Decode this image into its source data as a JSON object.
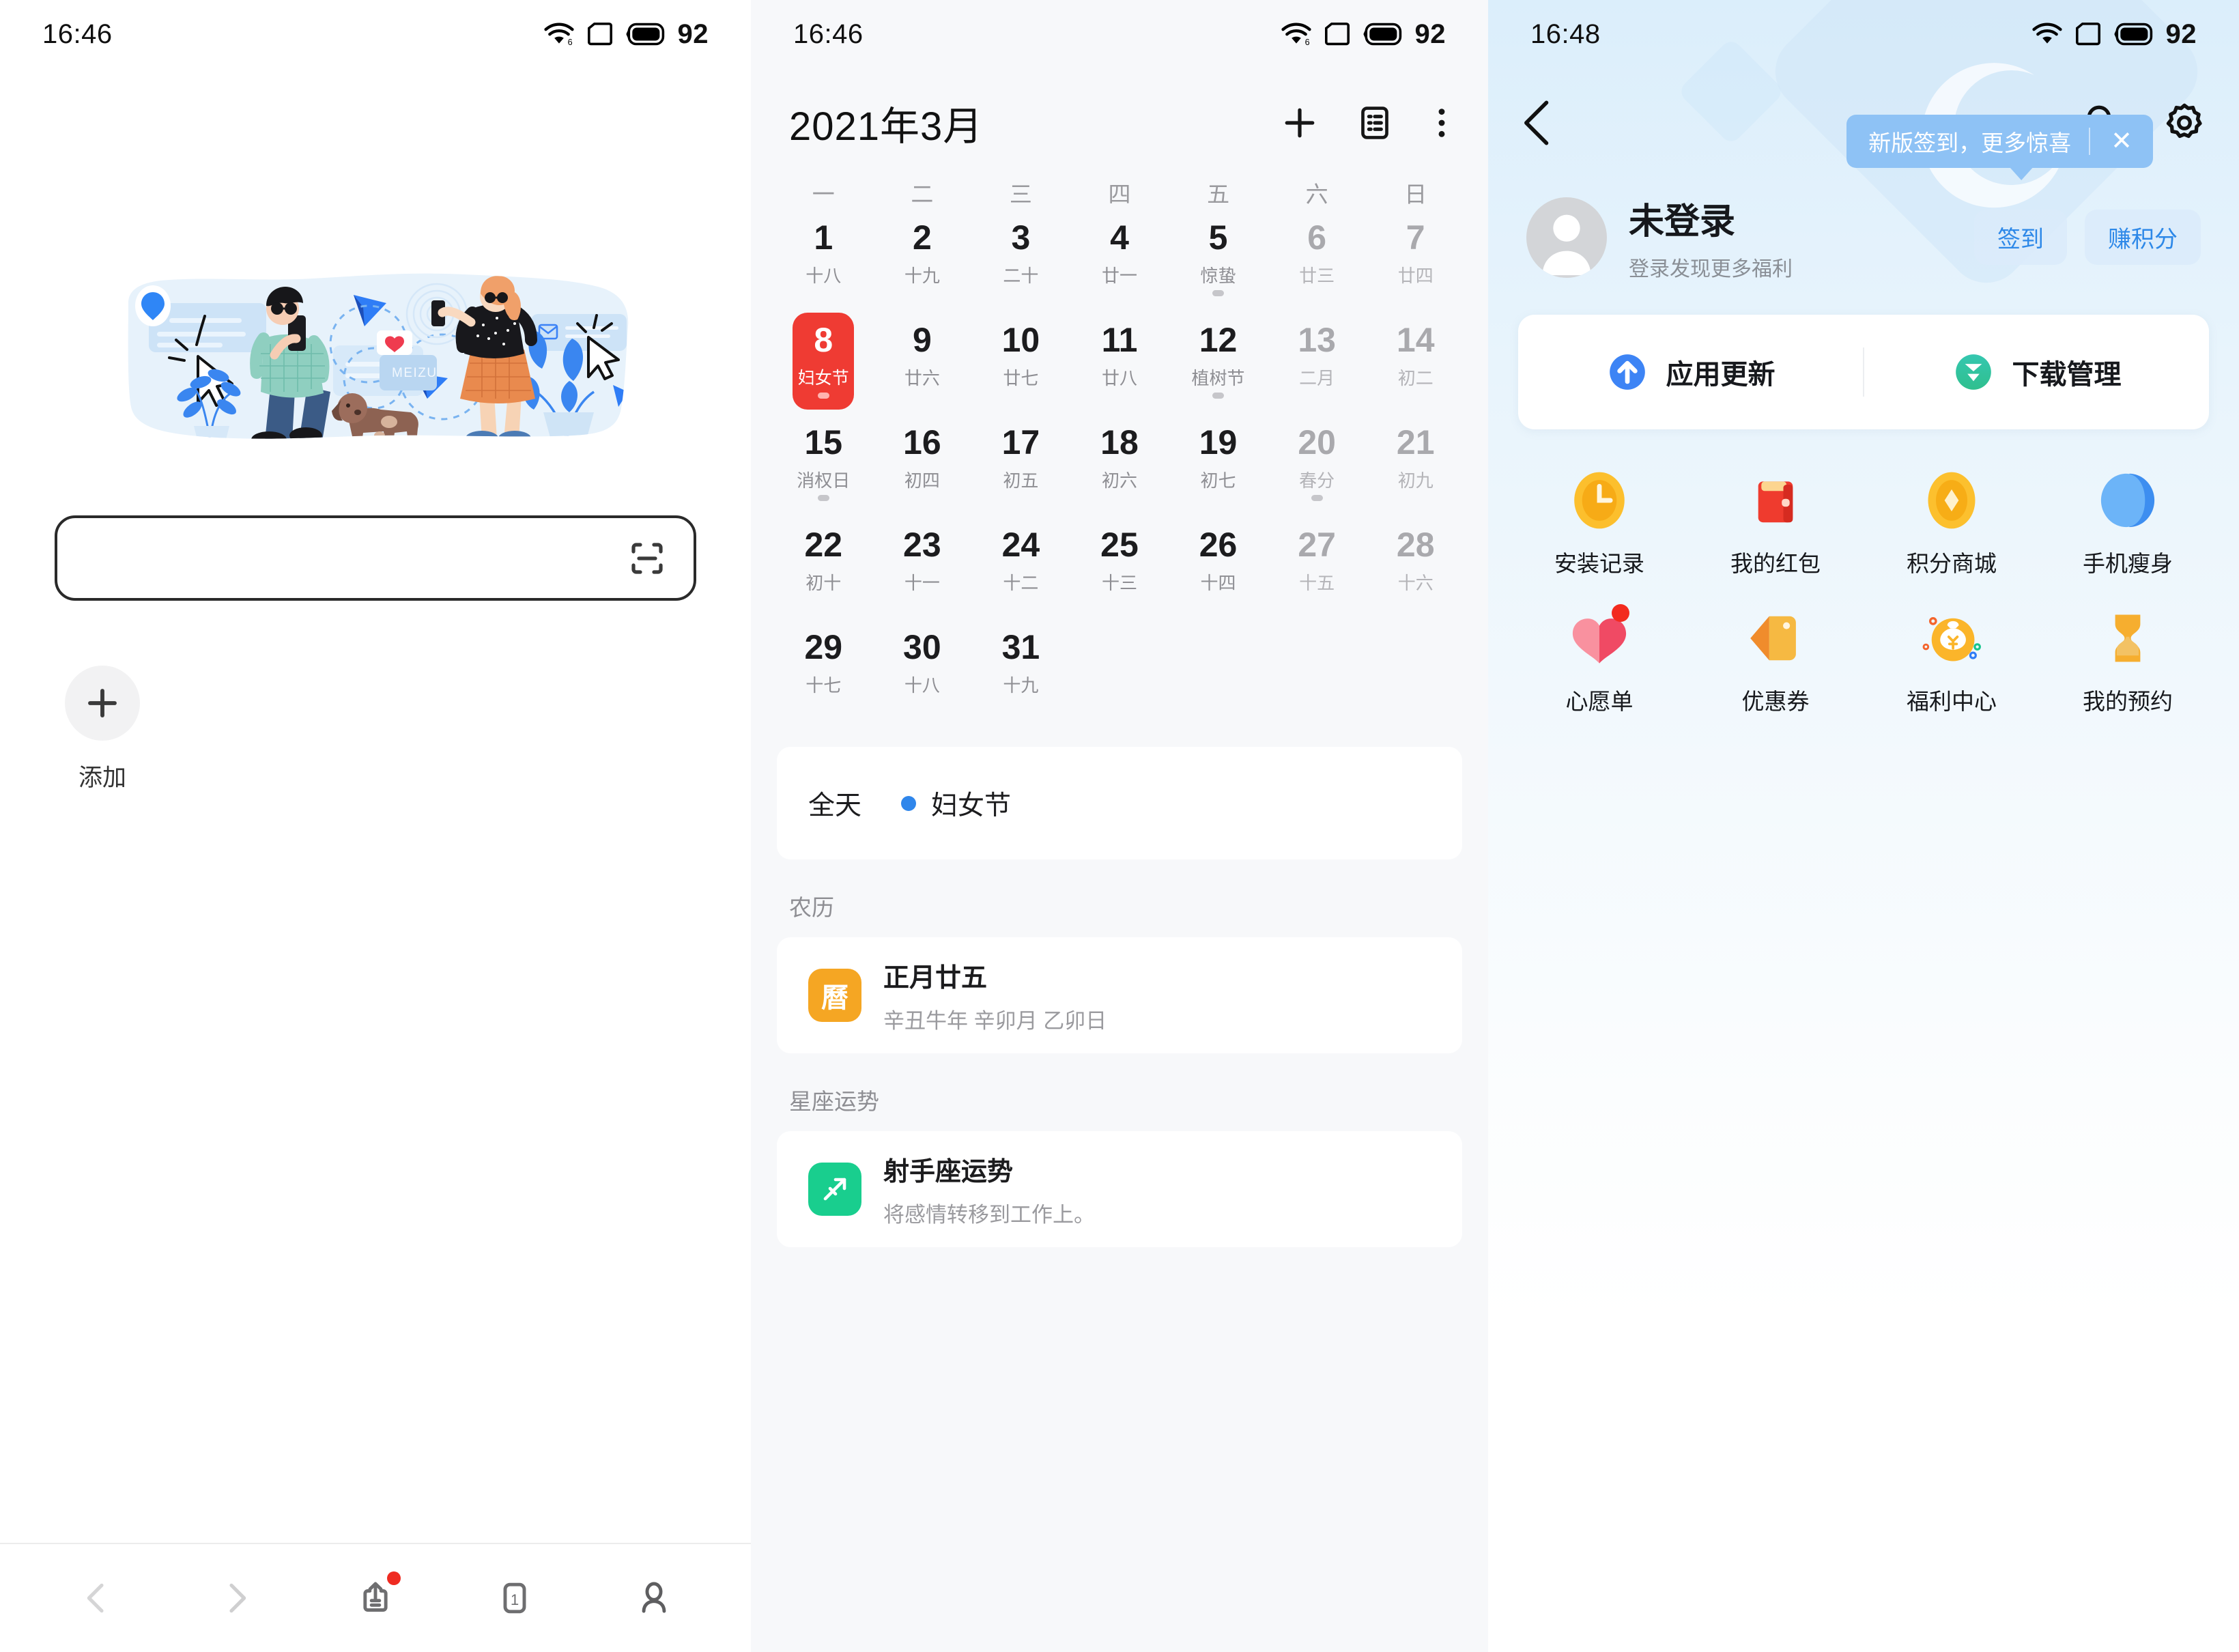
{
  "panel1": {
    "status": {
      "time": "16:46",
      "wifi_icon": "wifi-6-icon",
      "sim_icon": "sim-card-icon",
      "battery_icon": "battery-icon",
      "battery_level": "92"
    },
    "illustration": {
      "name": "meizu-browser-illustration",
      "brand_text": "MEIZU"
    },
    "search": {
      "value": "",
      "placeholder": "",
      "scan_icon": "scan-qr-icon"
    },
    "add_shortcut": {
      "icon": "plus-icon",
      "label": "添加"
    },
    "bottom_nav": [
      {
        "name": "back",
        "icon": "chevron-left-icon",
        "label": "",
        "disabled": true,
        "badge": false
      },
      {
        "name": "forward",
        "icon": "chevron-right-icon",
        "label": "",
        "disabled": true,
        "badge": false
      },
      {
        "name": "share",
        "icon": "share-upload-icon",
        "label": "",
        "disabled": false,
        "badge": true
      },
      {
        "name": "tabs",
        "icon": "tab-count-icon",
        "label": "1",
        "disabled": false,
        "badge": false
      },
      {
        "name": "profile",
        "icon": "person-icon",
        "label": "",
        "disabled": false,
        "badge": false
      }
    ]
  },
  "panel2": {
    "status": {
      "time": "16:46",
      "wifi_icon": "wifi-6-icon",
      "sim_icon": "sim-card-icon",
      "battery_icon": "battery-icon",
      "battery_level": "92"
    },
    "header": {
      "title": "2021年3月",
      "add_icon": "plus-icon",
      "agenda_icon": "agenda-list-icon",
      "more_icon": "more-vertical-icon"
    },
    "weekdays": [
      "一",
      "二",
      "三",
      "四",
      "五",
      "六",
      "日"
    ],
    "days": [
      {
        "num": "1",
        "lunar": "十八",
        "dim": false,
        "sel": false,
        "dot": false
      },
      {
        "num": "2",
        "lunar": "十九",
        "dim": false,
        "sel": false,
        "dot": false
      },
      {
        "num": "3",
        "lunar": "二十",
        "dim": false,
        "sel": false,
        "dot": false
      },
      {
        "num": "4",
        "lunar": "廿一",
        "dim": false,
        "sel": false,
        "dot": false
      },
      {
        "num": "5",
        "lunar": "惊蛰",
        "dim": false,
        "sel": false,
        "dot": true
      },
      {
        "num": "6",
        "lunar": "廿三",
        "dim": true,
        "sel": false,
        "dot": false
      },
      {
        "num": "7",
        "lunar": "廿四",
        "dim": true,
        "sel": false,
        "dot": false
      },
      {
        "num": "8",
        "lunar": "妇女节",
        "dim": false,
        "sel": true,
        "dot": true
      },
      {
        "num": "9",
        "lunar": "廿六",
        "dim": false,
        "sel": false,
        "dot": false
      },
      {
        "num": "10",
        "lunar": "廿七",
        "dim": false,
        "sel": false,
        "dot": false
      },
      {
        "num": "11",
        "lunar": "廿八",
        "dim": false,
        "sel": false,
        "dot": false
      },
      {
        "num": "12",
        "lunar": "植树节",
        "dim": false,
        "sel": false,
        "dot": true
      },
      {
        "num": "13",
        "lunar": "二月",
        "dim": true,
        "sel": false,
        "dot": false
      },
      {
        "num": "14",
        "lunar": "初二",
        "dim": true,
        "sel": false,
        "dot": false
      },
      {
        "num": "15",
        "lunar": "消权日",
        "dim": false,
        "sel": false,
        "dot": true
      },
      {
        "num": "16",
        "lunar": "初四",
        "dim": false,
        "sel": false,
        "dot": false
      },
      {
        "num": "17",
        "lunar": "初五",
        "dim": false,
        "sel": false,
        "dot": false
      },
      {
        "num": "18",
        "lunar": "初六",
        "dim": false,
        "sel": false,
        "dot": false
      },
      {
        "num": "19",
        "lunar": "初七",
        "dim": false,
        "sel": false,
        "dot": false
      },
      {
        "num": "20",
        "lunar": "春分",
        "dim": true,
        "sel": false,
        "dot": true
      },
      {
        "num": "21",
        "lunar": "初九",
        "dim": true,
        "sel": false,
        "dot": false
      },
      {
        "num": "22",
        "lunar": "初十",
        "dim": false,
        "sel": false,
        "dot": false
      },
      {
        "num": "23",
        "lunar": "十一",
        "dim": false,
        "sel": false,
        "dot": false
      },
      {
        "num": "24",
        "lunar": "十二",
        "dim": false,
        "sel": false,
        "dot": false
      },
      {
        "num": "25",
        "lunar": "十三",
        "dim": false,
        "sel": false,
        "dot": false
      },
      {
        "num": "26",
        "lunar": "十四",
        "dim": false,
        "sel": false,
        "dot": false
      },
      {
        "num": "27",
        "lunar": "十五",
        "dim": true,
        "sel": false,
        "dot": false
      },
      {
        "num": "28",
        "lunar": "十六",
        "dim": true,
        "sel": false,
        "dot": false
      },
      {
        "num": "29",
        "lunar": "十七",
        "dim": false,
        "sel": false,
        "dot": false
      },
      {
        "num": "30",
        "lunar": "十八",
        "dim": false,
        "sel": false,
        "dot": false
      },
      {
        "num": "31",
        "lunar": "十九",
        "dim": false,
        "sel": false,
        "dot": false
      }
    ],
    "event": {
      "time_label": "全天",
      "name": "妇女节",
      "color": "#2f86eb"
    },
    "lunar_section": {
      "heading": "农历",
      "icon_glyph": "曆",
      "icon_name": "lunar-calendar-icon",
      "title": "正月廿五",
      "subtitle": "辛丑牛年 辛卯月 乙卯日"
    },
    "horoscope_section": {
      "heading": "星座运势",
      "icon_name": "sagittarius-icon",
      "title": "射手座运势",
      "subtitle": "将感情转移到工作上。"
    }
  },
  "panel3": {
    "status": {
      "time": "16:48",
      "wifi_icon": "wifi-icon",
      "sim_icon": "sim-card-icon",
      "battery_icon": "battery-icon",
      "battery_level": "92"
    },
    "header": {
      "back_icon": "chevron-left-icon",
      "bell_icon": "bell-icon",
      "settings_icon": "gear-icon"
    },
    "tooltip": {
      "text": "新版签到，更多惊喜",
      "close_icon": "close-icon"
    },
    "user": {
      "avatar_icon": "default-avatar-icon",
      "name": "未登录",
      "subtitle": "登录发现更多福利",
      "buttons": [
        "签到",
        "赚积分"
      ]
    },
    "quick_card": [
      {
        "label": "应用更新",
        "icon": "arrow-up-circle-icon",
        "color": "#3d84f5"
      },
      {
        "label": "下载管理",
        "icon": "arrow-down-circle-icon",
        "color": "#27c59a"
      }
    ],
    "grid": [
      {
        "label": "安装记录",
        "icon": "clock-coin-icon",
        "color": "#fcbf2d",
        "badge": false
      },
      {
        "label": "我的红包",
        "icon": "red-wallet-icon",
        "color": "#f04134",
        "badge": false
      },
      {
        "label": "积分商城",
        "icon": "gold-coin-icon",
        "color": "#fcc02e",
        "badge": false
      },
      {
        "label": "手机瘦身",
        "icon": "phone-clean-icon",
        "color": "#3d8ef0",
        "badge": false
      },
      {
        "label": "心愿单",
        "icon": "heart-icon",
        "color": "#f4566b",
        "badge": true
      },
      {
        "label": "优惠券",
        "icon": "coupon-tag-icon",
        "color": "#f5a230",
        "badge": false
      },
      {
        "label": "福利中心",
        "icon": "money-bag-icon",
        "color": "#fbb52a",
        "badge": false
      },
      {
        "label": "我的预约",
        "icon": "hourglass-icon",
        "color": "#f7ab2c",
        "badge": false
      }
    ]
  }
}
